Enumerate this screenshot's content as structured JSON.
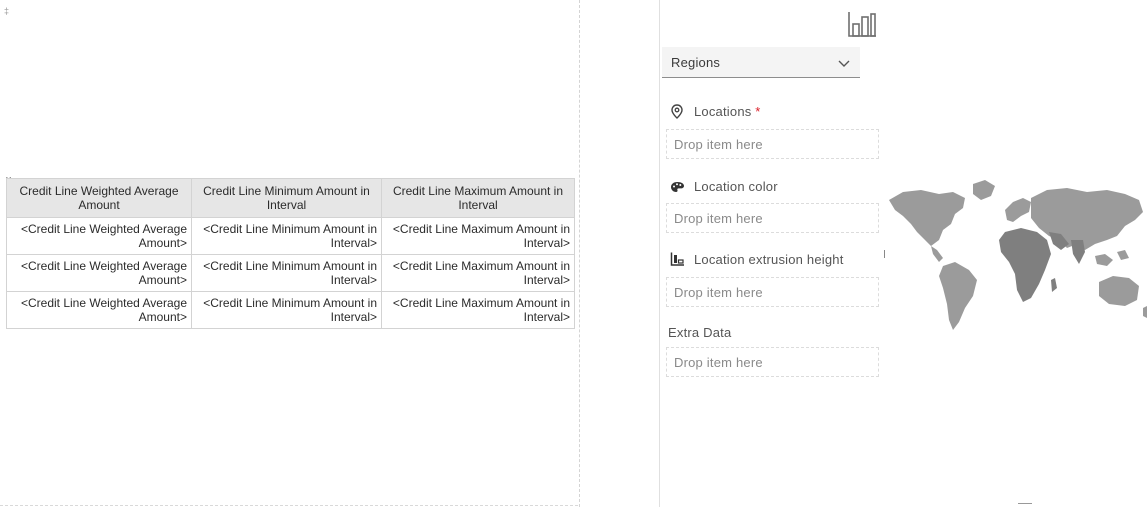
{
  "report": {
    "corner_marker": "‡",
    "table_handle": "∷",
    "columns": [
      "Credit Line Weighted Average Amount",
      "Credit Line Minimum Amount in Interval",
      "Credit Line Maximum Amount in Interval"
    ],
    "rows": [
      [
        "<Credit Line Weighted Average Amount>",
        "<Credit Line Minimum Amount in Interval>",
        "<Credit Line Maximum Amount in Interval>"
      ],
      [
        "<Credit Line Weighted Average Amount>",
        "<Credit Line Minimum Amount in Interval>",
        "<Credit Line Maximum Amount in Interval>"
      ],
      [
        "<Credit Line Weighted Average Amount>",
        "<Credit Line Minimum Amount in Interval>",
        "<Credit Line Maximum Amount in Interval>"
      ]
    ]
  },
  "panel": {
    "chart_icon": "bar-chart-icon",
    "dropdown": {
      "selected": "Regions",
      "icon": "chevron-down-icon"
    },
    "slots": [
      {
        "label": "Locations",
        "required_mark": "*",
        "icon": "location-pin-icon",
        "placeholder": "Drop item here"
      },
      {
        "label": "Location color",
        "icon": "color-palette-icon",
        "placeholder": "Drop item here"
      },
      {
        "label": "Location extrusion height",
        "icon": "extrusion-height-icon",
        "placeholder": "Drop item here"
      },
      {
        "label": "Extra Data",
        "placeholder": "Drop item here"
      }
    ]
  },
  "map": {
    "colors": {
      "land": "#9b9b9b",
      "land_dark": "#7f7f7f"
    }
  }
}
